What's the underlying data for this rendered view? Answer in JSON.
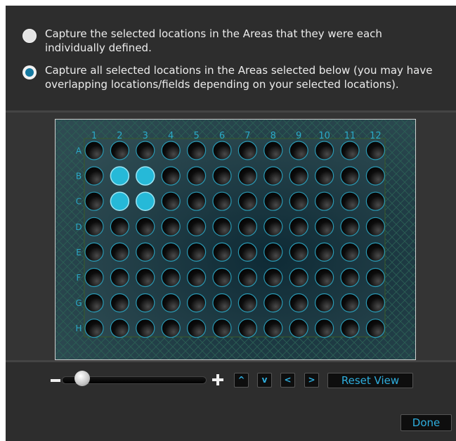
{
  "options": [
    {
      "label": "Capture the selected locations in the Areas that they were each individually defined.",
      "selected": false
    },
    {
      "label": "Capture all selected locations in the Areas selected below (you may have overlapping locations/fields depending on your selected locations).",
      "selected": true
    }
  ],
  "plate": {
    "columns": [
      "1",
      "2",
      "3",
      "4",
      "5",
      "6",
      "7",
      "8",
      "9",
      "10",
      "11",
      "12"
    ],
    "rows": [
      "A",
      "B",
      "C",
      "D",
      "E",
      "F",
      "G",
      "H"
    ],
    "selected_wells": [
      "B2",
      "B3",
      "C2",
      "C3"
    ],
    "colors": {
      "label": "#2aa9c8",
      "selected_well": "#26b9d8",
      "well_outline": "#2a9ab5",
      "background": "#1f3f4a"
    }
  },
  "zoom": {
    "level": 0.1
  },
  "controls": {
    "up_label": "^",
    "down_label": "v",
    "left_label": "<",
    "right_label": ">",
    "reset_label": "Reset View",
    "done_label": "Done"
  }
}
